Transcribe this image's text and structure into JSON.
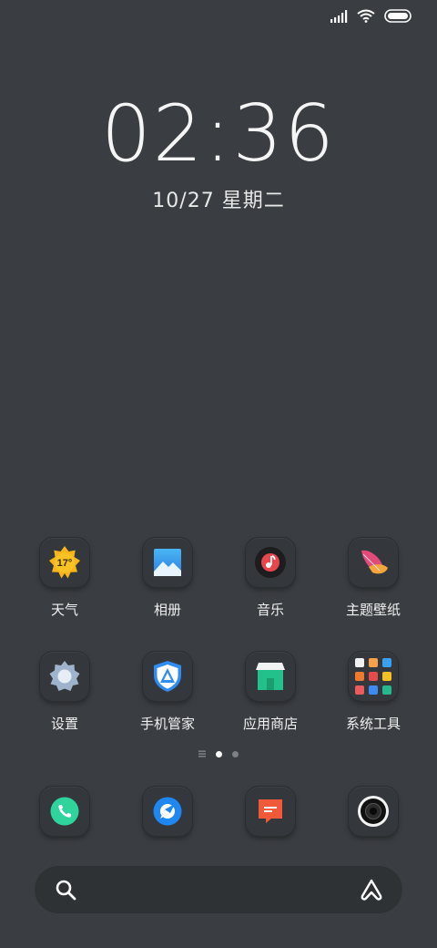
{
  "status_bar": {
    "icons": [
      "signal-icon",
      "wifi-icon",
      "battery-icon"
    ]
  },
  "clock": {
    "time": "02:36",
    "date": "10/27 星期二"
  },
  "weather_widget": {
    "temp": "17°"
  },
  "apps": [
    {
      "label": "天气",
      "icon": "weather-icon"
    },
    {
      "label": "相册",
      "icon": "gallery-icon"
    },
    {
      "label": "音乐",
      "icon": "music-icon"
    },
    {
      "label": "主题壁纸",
      "icon": "themes-icon"
    },
    {
      "label": "设置",
      "icon": "settings-gear-icon"
    },
    {
      "label": "手机管家",
      "icon": "security-shield-icon"
    },
    {
      "label": "应用商店",
      "icon": "app-store-icon"
    },
    {
      "label": "系统工具",
      "icon": "folder-icon"
    }
  ],
  "pages": {
    "total": 2,
    "current": 1
  },
  "dock": [
    {
      "icon": "phone-icon"
    },
    {
      "icon": "browser-icon"
    },
    {
      "icon": "messages-icon"
    },
    {
      "icon": "camera-icon"
    }
  ],
  "search_bar": {
    "icons": [
      "search-icon",
      "assistant-icon"
    ]
  }
}
